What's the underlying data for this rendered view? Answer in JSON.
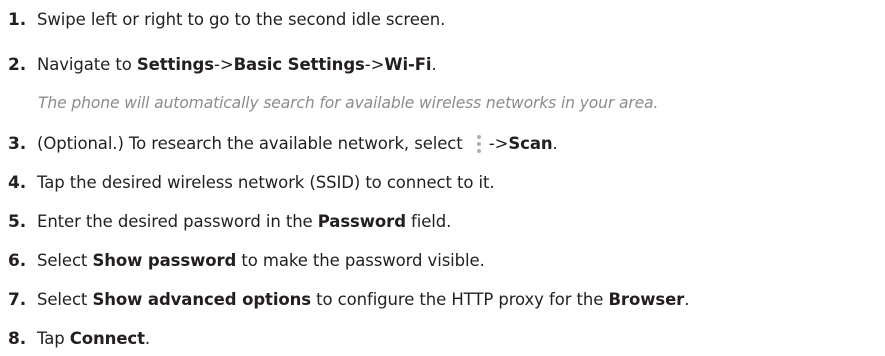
{
  "steps": [
    {
      "number": "1.",
      "text": "Swipe left or right to go to the second idle screen."
    },
    {
      "number": "2.",
      "prefix": "Navigate to ",
      "bold1": "Settings",
      "sep1": "->",
      "bold2": "Basic Settings",
      "sep2": "->",
      "bold3": "Wi-Fi",
      "suffix": ".",
      "note": "The phone will automatically search for available wireless networks in your area."
    },
    {
      "number": "3.",
      "prefix": "(Optional.) To research the available network, select ",
      "icon": "more-options-kebab-icon",
      "sep": "->",
      "bold": "Scan",
      "suffix": "."
    },
    {
      "number": "4.",
      "text": "Tap the desired wireless network (SSID) to connect to it."
    },
    {
      "number": "5.",
      "prefix": "Enter the desired password in the ",
      "bold": "Password",
      "suffix": " field."
    },
    {
      "number": "6.",
      "prefix": "Select ",
      "bold": "Show password",
      "suffix": " to make the password visible."
    },
    {
      "number": "7.",
      "prefix": "Select ",
      "bold1": "Show advanced options",
      "middle": " to configure the HTTP proxy for the ",
      "bold2": "Browser",
      "suffix": "."
    },
    {
      "number": "8.",
      "prefix": "Tap ",
      "bold": "Connect",
      "suffix": "."
    }
  ],
  "colors": {
    "text": "#231f20",
    "note": "#8c8c8c",
    "icon": "#b0b0b0"
  }
}
